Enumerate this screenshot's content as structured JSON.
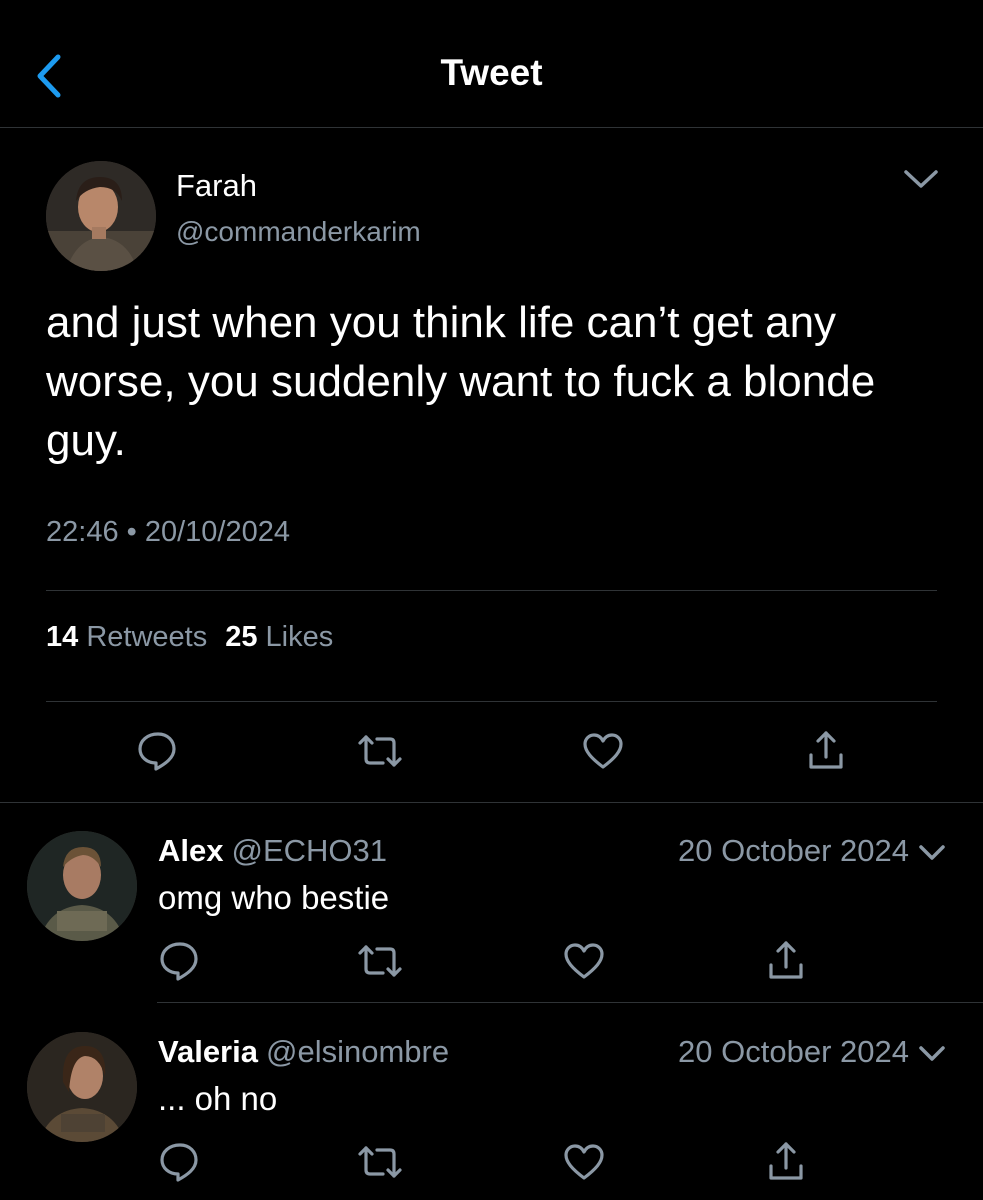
{
  "header": {
    "title": "Tweet"
  },
  "tweet": {
    "author_name": "Farah",
    "author_handle": "@commanderkarim",
    "text": "and just when you think life can’t get any worse, you suddenly want to fuck a blonde guy.",
    "timestamp": "22:46 • 20/10/2024",
    "retweets_count": "14",
    "retweets_label": "Retweets",
    "likes_count": "25",
    "likes_label": "Likes"
  },
  "replies": [
    {
      "name": "Alex",
      "handle": "@ECHO31",
      "date": "20 October 2024",
      "text": "omg who bestie"
    },
    {
      "name": "Valeria",
      "handle": "@elsinombre",
      "date": "20 October 2024",
      "text": "... oh no"
    }
  ],
  "colors": {
    "accent": "#1d9bf0",
    "secondary_text": "#8b98a5",
    "background": "#000000",
    "divider": "#2f3336"
  },
  "icons": [
    "back-arrow-icon",
    "chevron-down-icon",
    "reply-icon",
    "retweet-icon",
    "like-icon",
    "share-icon"
  ]
}
